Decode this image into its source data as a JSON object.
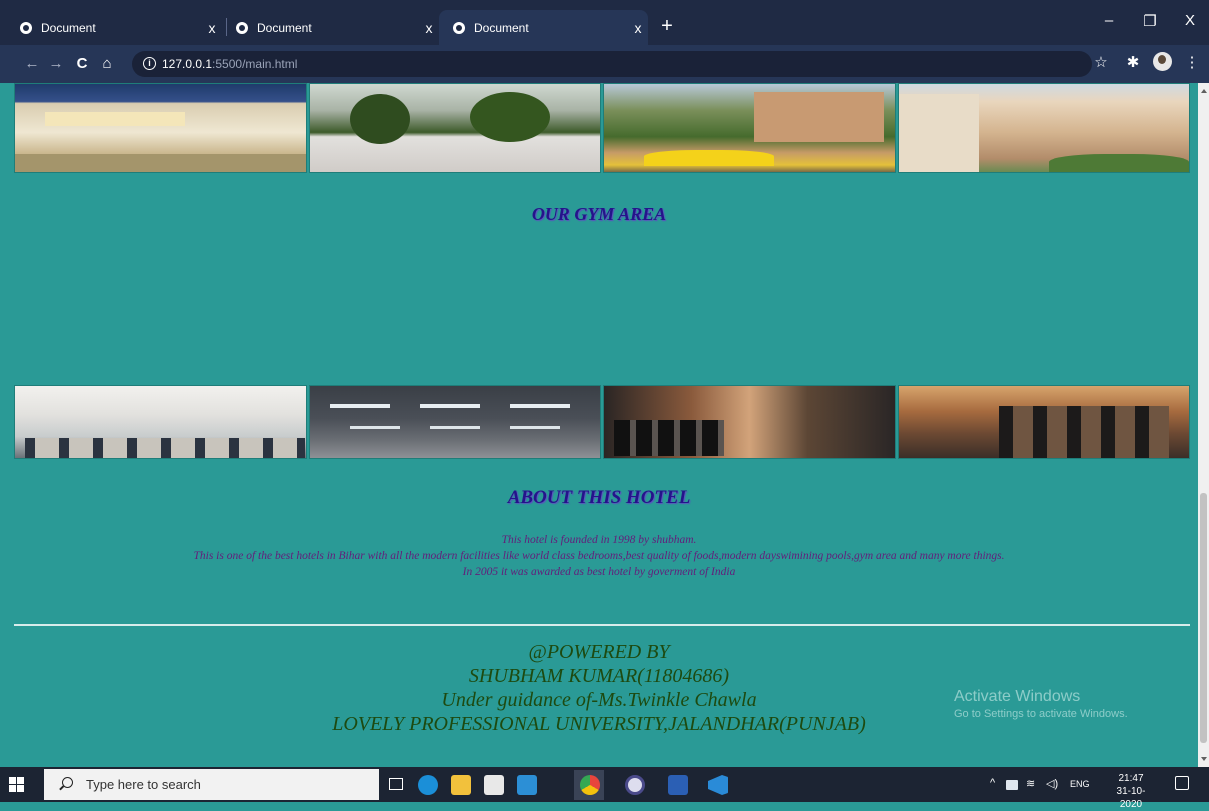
{
  "browser": {
    "tabs": [
      {
        "label": "Document",
        "close": "x"
      },
      {
        "label": "Document",
        "close": "x"
      },
      {
        "label": "Document",
        "close": "x"
      }
    ],
    "new_tab": "+",
    "window_controls": {
      "minimize": "–",
      "restore": "❐",
      "close": "X"
    },
    "url": {
      "host": "127.0.0.1",
      "rest": ":5500/main.html"
    },
    "nav": {
      "back": "←",
      "forward": "→",
      "reload": "C",
      "home": "⌂"
    },
    "toolbar_icons": {
      "star": "☆",
      "extensions": "✱",
      "menu": "⋮"
    }
  },
  "page": {
    "hotel_images": [
      "hotel-lobby-photo",
      "hotel-palm-garden-photo",
      "hotel-pool-umbrellas-photo",
      "hotel-exterior-photo"
    ],
    "gym_heading": "OUR GYM AREA",
    "gym_images": [
      "gym-hall-photo",
      "gym-ceiling-photo",
      "gym-weights-photo",
      "gym-machines-photo"
    ],
    "about_heading": "ABOUT THIS HOTEL",
    "about_lines": [
      "This hotel is founded in 1998 by shubham.",
      "This is one of the best hotels in Bihar with all the modern facilities like world class bedrooms,best quality of foods,modern dayswimining pools,gym area and many more things.",
      "In 2005 it was awarded as best hotel by goverment of India"
    ],
    "footer_lines": [
      "@POWERED BY",
      "SHUBHAM KUMAR(11804686)",
      "Under guidance of-Ms.Twinkle Chawla",
      "LOVELY PROFESSIONAL UNIVERSITY,JALANDHAR(PUNJAB)"
    ],
    "watermark": {
      "title": "Activate Windows",
      "subtitle": "Go to Settings to activate Windows."
    }
  },
  "taskbar": {
    "search_placeholder": "Type here to search",
    "apps": [
      "edge-icon",
      "file-explorer-icon",
      "store-icon",
      "mail-icon",
      "chrome-icon",
      "media-icon",
      "word-icon",
      "vscode-icon"
    ],
    "tray": {
      "chevron": "^",
      "language": "ENG"
    },
    "clock": {
      "time": "21:47",
      "date": "31-10-2020"
    }
  },
  "colors": {
    "page_bg": "#2a9a96",
    "heading": "#24148a",
    "about_text": "#63207b",
    "footer_text": "#1d4a10",
    "titlebar": "#1f2a44"
  }
}
